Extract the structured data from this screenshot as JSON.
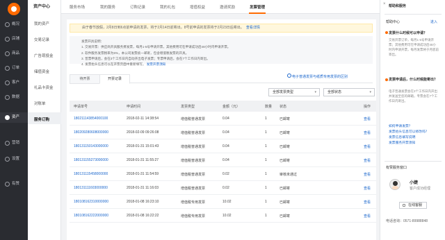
{
  "nav": {
    "items": [
      {
        "label": "概况"
      },
      {
        "label": "店铺"
      },
      {
        "label": "商品"
      },
      {
        "label": "订单"
      },
      {
        "label": "客户"
      },
      {
        "label": "数据"
      },
      {
        "label": "资产"
      },
      {
        "label": "营销"
      },
      {
        "label": "设置"
      },
      {
        "label": "有赞"
      }
    ]
  },
  "sub": {
    "title": "资产中心",
    "items": [
      "我的资产",
      "交易记录",
      "广告现投金",
      "储值资金",
      "礼品卡资金",
      "对账单",
      "服务订购"
    ]
  },
  "tabs": [
    "服务市场",
    "我的服务",
    "订购记录",
    "我的礼包",
    "增值权益",
    "邀请奖励",
    "发票管理"
  ],
  "notice": {
    "text": "由于春节放假，2月8日到6点前申请的发票，将于2月14日前寄出，8号前申请的发票将于2月23日后寄出。",
    "link": "查看详情"
  },
  "info": [
    "发票开具说明：",
    "1. 交易开票：供应商开具服务费发票，每月1-5号申请开票，其他费用可在申请成功后48小时内申请开票。",
    "2. 软件服务发票税率为6%，本公司发票统一邮寄，包含增值税发票的开具。",
    "3. 普票申请后，会在3个工作日内自动开出电子发票；专票申请后，会在7个工作日内寄出。",
    "4. 发票抬头信息可以在开票页面中重新填写。"
  ],
  "info_link": "发票开票须知",
  "subtabs": [
    "待开票",
    "开票记录"
  ],
  "ext_link": "电子普通发票与纸质专用发票的区别",
  "filters": {
    "type": "全部发票类型",
    "status": "全部状态"
  },
  "table": {
    "headers": [
      "申请单号",
      "申请时间",
      "发票类型",
      "金额（元）",
      "数量",
      "状态",
      "操作"
    ],
    "rows": [
      [
        "180211143854000100",
        "2018-02-11 14:38:54",
        "增值税普通发票",
        "0.04",
        "1",
        "已邮寄",
        "查看"
      ],
      [
        "180209280608000000",
        "2018-02-09 09:26:08",
        "增值税普通发票",
        "0.04",
        "1",
        "已邮寄",
        "查看"
      ],
      [
        "180131150143000000",
        "2018-01-31 15:01:43",
        "增值税普通发票",
        "0.04",
        "1",
        "已邮寄",
        "查看"
      ],
      [
        "180131155273000000",
        "2018-01-31 11:55:27",
        "增值税普通发票",
        "0.04",
        "1",
        "已邮寄",
        "查看"
      ],
      [
        "180131115458000000",
        "2018-01-31 11:54:59",
        "增值税普通发票",
        "0.02",
        "1",
        "审核未通过",
        "查看"
      ],
      [
        "180131111603000000",
        "2018-01-31 11:16:03",
        "增值税普通发票",
        "0.02",
        "1",
        "已邮寄",
        "查看"
      ],
      [
        "180108162310000000",
        "2018-01-08 16:23:10",
        "增值税专用发票",
        "10.02",
        "1",
        "已邮寄",
        "查看"
      ],
      [
        "180108162222000000",
        "2018-01-08 16:22:22",
        "增值税专用发票",
        "10.02",
        "1",
        "已邮寄",
        "查看"
      ]
    ]
  },
  "right": {
    "top": "帮助和服务",
    "help_title": "帮助中心",
    "help_more": "进入",
    "q1": "发票什么时候可以申请？",
    "a1": "交易开票订单，每月1-5号申请开票；其他费用可在申请成功后48小时内申请开票，每月发票将于月底前寄出。",
    "q2": "发票申请后，什么时候能寄出？",
    "a2": "电子普通发票会在3个工作日内开出并发送至您的邮箱，专票会在7个工作日内寄出。",
    "links": [
      "如何申请发票？",
      "发票抬头信息可以修改吗？",
      "发票信息填写说明",
      "发票服务开票须知"
    ],
    "service_title": "有赞服务窗口",
    "agent_name": "小婕",
    "agent_role": "客户成功经理",
    "online_btn": "在线客服",
    "phone": "电话咨询：0571-89988848"
  }
}
